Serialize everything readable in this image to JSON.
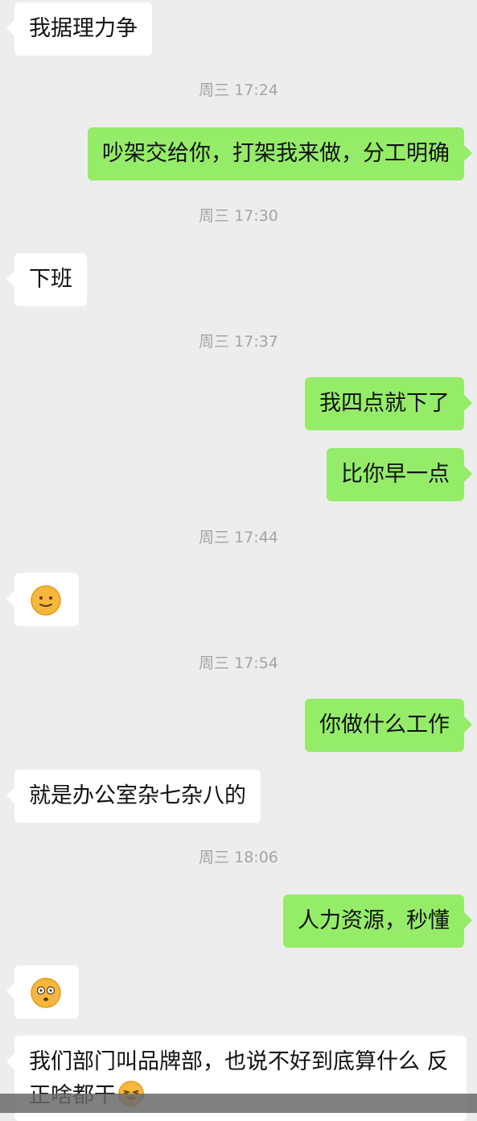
{
  "chat": {
    "messages": [
      {
        "kind": "text",
        "side": "left",
        "text": "我据理力争"
      },
      {
        "kind": "time",
        "text": "周三 17:24"
      },
      {
        "kind": "text",
        "side": "right",
        "text": "吵架交给你，打架我来做，分工明确"
      },
      {
        "kind": "time",
        "text": "周三 17:30"
      },
      {
        "kind": "text",
        "side": "left",
        "text": "下班"
      },
      {
        "kind": "time",
        "text": "周三 17:37"
      },
      {
        "kind": "text",
        "side": "right",
        "text": "我四点就下了"
      },
      {
        "kind": "text",
        "side": "right",
        "text": "比你早一点"
      },
      {
        "kind": "time",
        "text": "周三 17:44"
      },
      {
        "kind": "emoji",
        "side": "left",
        "emoji": "smile-face-icon"
      },
      {
        "kind": "time",
        "text": "周三 17:54"
      },
      {
        "kind": "text",
        "side": "right",
        "text": "你做什么工作"
      },
      {
        "kind": "text",
        "side": "left",
        "text": "就是办公室杂七杂八的"
      },
      {
        "kind": "time",
        "text": "周三 18:06"
      },
      {
        "kind": "text",
        "side": "right",
        "text": "人力资源，秒懂"
      },
      {
        "kind": "emoji",
        "side": "left",
        "emoji": "surprised-face-icon"
      },
      {
        "kind": "text",
        "side": "left",
        "text": "我们部门叫品牌部，也说不好到底算什么 反正啥都干",
        "trailing_emoji": "crying-laugh-face-icon"
      }
    ]
  },
  "colors": {
    "background": "#ededed",
    "sent_bubble": "#95ec69",
    "received_bubble": "#ffffff",
    "timestamp": "#a4a4a4"
  }
}
